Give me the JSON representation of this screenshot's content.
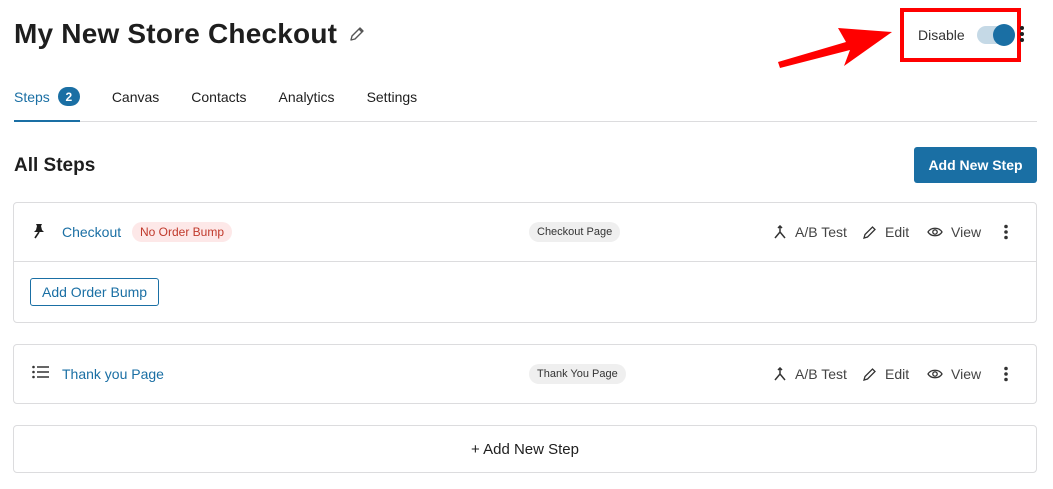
{
  "header": {
    "title": "My New Store Checkout"
  },
  "status": {
    "label": "Disable",
    "enabled": true
  },
  "tabs": [
    {
      "label": "Steps",
      "badge": "2"
    },
    {
      "label": "Canvas"
    },
    {
      "label": "Contacts"
    },
    {
      "label": "Analytics"
    },
    {
      "label": "Settings"
    }
  ],
  "steps_section": {
    "title": "All Steps",
    "add_button": "Add New Step"
  },
  "steps": [
    {
      "name": "Checkout",
      "badge": "No Order Bump",
      "type": "Checkout Page",
      "ab_test": "A/B Test",
      "edit": "Edit",
      "view": "View",
      "sub_button": "Add Order Bump"
    },
    {
      "name": "Thank you Page",
      "type": "Thank You Page",
      "ab_test": "A/B Test",
      "edit": "Edit",
      "view": "View"
    }
  ],
  "bottom": {
    "add_label": "+ Add New Step"
  },
  "colors": {
    "accent": "#1a6fa4",
    "highlight": "#ff0000"
  }
}
